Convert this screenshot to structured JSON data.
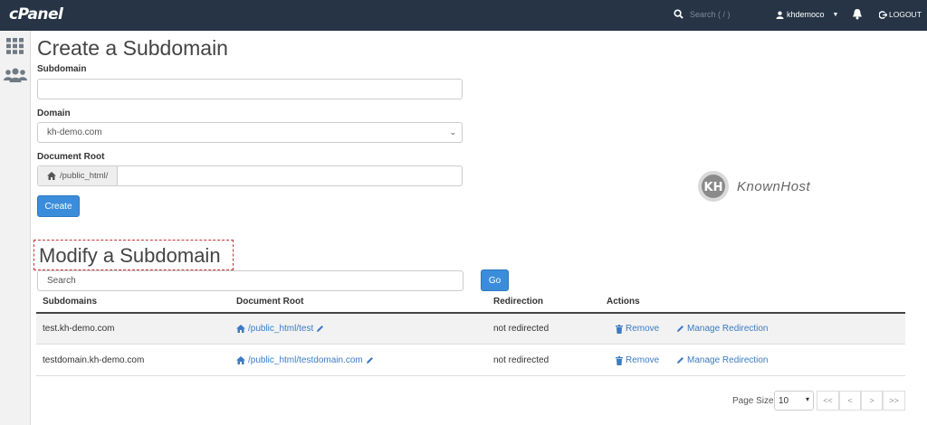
{
  "header": {
    "logo": "cPanel",
    "search_placeholder": "Search ( / )",
    "username": "khdemoco",
    "logout_label": "LOGOUT"
  },
  "create": {
    "title": "Create a Subdomain",
    "subdomain_label": "Subdomain",
    "subdomain_value": "",
    "domain_label": "Domain",
    "domain_value": "kh-demo.com",
    "docroot_label": "Document Root",
    "docroot_prefix": "/public_html/",
    "docroot_value": "",
    "create_button": "Create"
  },
  "modify": {
    "title": "Modify a Subdomain",
    "search_placeholder": "Search",
    "go_button": "Go",
    "columns": [
      "Subdomains",
      "Document Root",
      "Redirection",
      "Actions"
    ],
    "rows": [
      {
        "subdomain": "test.kh-demo.com",
        "docroot": "/public_html/test",
        "redirection": "not redirected",
        "remove": "Remove",
        "manage": "Manage Redirection"
      },
      {
        "subdomain": "testdomain.kh-demo.com",
        "docroot": "/public_html/testdomain.com",
        "redirection": "not redirected",
        "remove": "Remove",
        "manage": "Manage Redirection"
      }
    ],
    "page_size_label": "Page Size",
    "page_size_value": "10",
    "pager": [
      "<<",
      "<",
      ">",
      ">>"
    ]
  },
  "watermark": {
    "text": "KnownHost",
    "badge": "KH"
  },
  "colors": {
    "topbar": "#263445",
    "primary": "#3b8ddb",
    "link": "#3b7bc4",
    "highlight": "#c6323a"
  },
  "icons": [
    "search-icon",
    "user-icon",
    "caret-down-icon",
    "bell-icon",
    "logout-icon",
    "apps-grid-icon",
    "users-icon",
    "home-icon",
    "pencil-icon",
    "trash-icon"
  ]
}
